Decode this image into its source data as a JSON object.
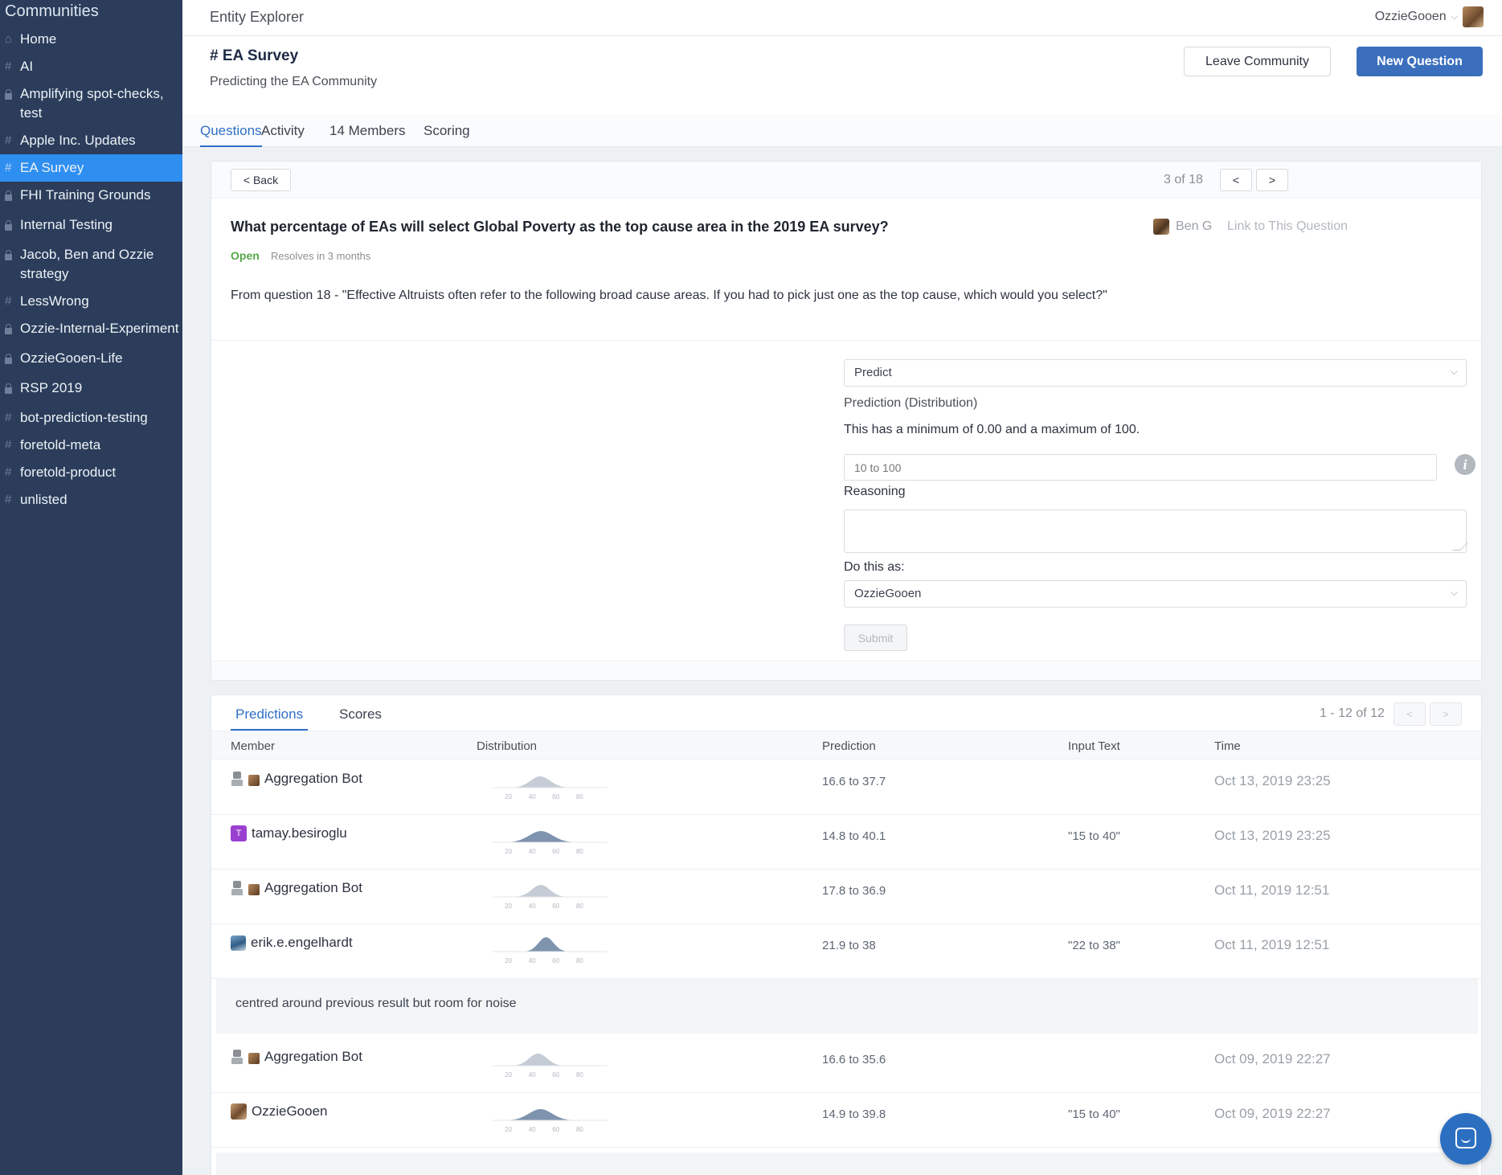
{
  "sidebar": {
    "title": "Communities",
    "items": [
      {
        "prefix": "home",
        "label": "Home"
      },
      {
        "prefix": "#",
        "label": "AI"
      },
      {
        "prefix": "lock",
        "label": "Amplifying spot-checks, test"
      },
      {
        "prefix": "#",
        "label": "Apple Inc. Updates"
      },
      {
        "prefix": "#",
        "label": "EA Survey",
        "active": true
      },
      {
        "prefix": "lock",
        "label": "FHI Training Grounds"
      },
      {
        "prefix": "lock",
        "label": "Internal Testing"
      },
      {
        "prefix": "lock",
        "label": "Jacob, Ben and Ozzie strategy"
      },
      {
        "prefix": "#",
        "label": "LessWrong"
      },
      {
        "prefix": "lock",
        "label": "Ozzie-Internal-Experiment"
      },
      {
        "prefix": "lock",
        "label": "OzzieGooen-Life"
      },
      {
        "prefix": "lock",
        "label": "RSP 2019"
      },
      {
        "prefix": "#",
        "label": "bot-prediction-testing"
      },
      {
        "prefix": "#",
        "label": "foretold-meta"
      },
      {
        "prefix": "#",
        "label": "foretold-product"
      },
      {
        "prefix": "#",
        "label": "unlisted"
      }
    ]
  },
  "topbar": {
    "title": "Entity Explorer",
    "user": "OzzieGooen"
  },
  "header": {
    "community_name": "# EA Survey",
    "subtitle": "Predicting the EA Community",
    "leave_label": "Leave Community",
    "new_question_label": "New Question"
  },
  "tabs": [
    {
      "label": "Questions",
      "active": true
    },
    {
      "label": "Activity"
    },
    {
      "label": "14 Members"
    },
    {
      "label": "Scoring"
    }
  ],
  "question": {
    "back_label": "< Back",
    "pager": "3 of 18",
    "prev_label": "<",
    "next_label": ">",
    "title": "What percentage of EAs will select Global Poverty as the top cause area in the 2019 EA survey?",
    "author": "Ben G",
    "link_label": "Link to This Question",
    "status": "Open",
    "resolves": "Resolves in 3 months",
    "description": "From question 18 - \"Effective Altruists often refer to the following broad cause areas. If you had to pick just one as the top cause, which would you select?\""
  },
  "form": {
    "mode_value": "Predict",
    "prediction_label": "Prediction (Distribution)",
    "range_text": "This has a minimum of 0.00 and a maximum of 100.",
    "input_placeholder": "10 to 100",
    "reasoning_label": "Reasoning",
    "do_as_label": "Do this as:",
    "do_as_value": "OzzieGooen",
    "submit_label": "Submit"
  },
  "predictions": {
    "tabs": [
      {
        "label": "Predictions",
        "active": true
      },
      {
        "label": "Scores"
      }
    ],
    "pager": "1 - 12 of 12",
    "prev_label": "<",
    "next_label": ">",
    "columns": [
      "Member",
      "Distribution",
      "Prediction",
      "Input Text",
      "Time"
    ],
    "axis_ticks": [
      "20",
      "40",
      "60",
      "80"
    ],
    "rows": [
      {
        "member": "Aggregation Bot",
        "avatar": "bot",
        "prediction": "16.6 to 37.7",
        "input": "",
        "time": "Oct 13, 2019 23:25",
        "dist_color": "#c5ccd5",
        "dist_center": 27.2,
        "dist_spread": 10.5
      },
      {
        "member": "tamay.besiroglu",
        "avatar": "T",
        "prediction": "14.8 to 40.1",
        "input": "\"15 to 40\"",
        "time": "Oct 13, 2019 23:25",
        "dist_color": "#7e93ad",
        "dist_center": 27.5,
        "dist_spread": 12.6
      },
      {
        "member": "Aggregation Bot",
        "avatar": "bot",
        "prediction": "17.8 to 36.9",
        "input": "",
        "time": "Oct 11, 2019 12:51",
        "dist_color": "#c5ccd5",
        "dist_center": 27.4,
        "dist_spread": 9.6
      },
      {
        "member": "erik.e.engelhardt",
        "avatar": "photo",
        "prediction": "21.9 to 38",
        "input": "\"22 to 38\"",
        "time": "Oct 11, 2019 12:51",
        "dist_color": "#7e93ad",
        "dist_center": 30.0,
        "dist_spread": 8.0,
        "reasoning": "centred around previous result but room for noise"
      },
      {
        "member": "Aggregation Bot",
        "avatar": "bot",
        "prediction": "16.6 to 35.6",
        "input": "",
        "time": "Oct 09, 2019 22:27",
        "dist_color": "#c5ccd5",
        "dist_center": 26.1,
        "dist_spread": 9.5
      },
      {
        "member": "OzzieGooen",
        "avatar": "ozzie",
        "prediction": "14.9 to 39.8",
        "input": "\"15 to 40\"",
        "time": "Oct 09, 2019 22:27",
        "dist_color": "#7e93ad",
        "dist_center": 27.3,
        "dist_spread": 12.4
      }
    ]
  },
  "colors": {
    "sidebar_bg": "#2b3d5b",
    "sidebar_active": "#2f8ff1",
    "primary": "#3b6fbd",
    "open_status": "#57a64a"
  }
}
